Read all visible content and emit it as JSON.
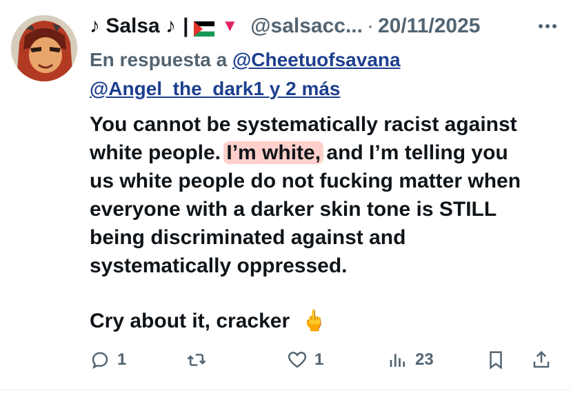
{
  "header": {
    "display_name": "♪ Salsa ♪",
    "separator": "|",
    "handle": "@salsacc...",
    "date": "20/11/2025"
  },
  "reply": {
    "prefix": "En respuesta a",
    "mention1": "@Cheetuofsavana",
    "mention2": "@Angel_the_dark1",
    "suffix": "y 2 más"
  },
  "body": {
    "before_highlight": "You cannot be systematically racist against\nwhite people. ",
    "highlight": "I’m white,",
    "after_highlight": " and I’m telling you\nus white people do not fucking matter when\neveryone with a darker skin tone is STILL\nbeing discriminated against and\nsystematically oppressed.",
    "closing": "Cry about it, cracker",
    "closing_emoji": "🖕"
  },
  "actions": {
    "replies": "1",
    "retweets": "",
    "likes": "1",
    "views": "23"
  },
  "colors": {
    "text": "#0f1419",
    "secondary": "#536471",
    "link": "#1d3f8f",
    "highlight": "#ff968c"
  },
  "icons": [
    "avatar",
    "palestine-flag-icon",
    "red-triangle-icon",
    "more-icon",
    "reply-icon",
    "retweet-icon",
    "like-icon",
    "views-icon",
    "bookmark-icon",
    "share-icon"
  ]
}
